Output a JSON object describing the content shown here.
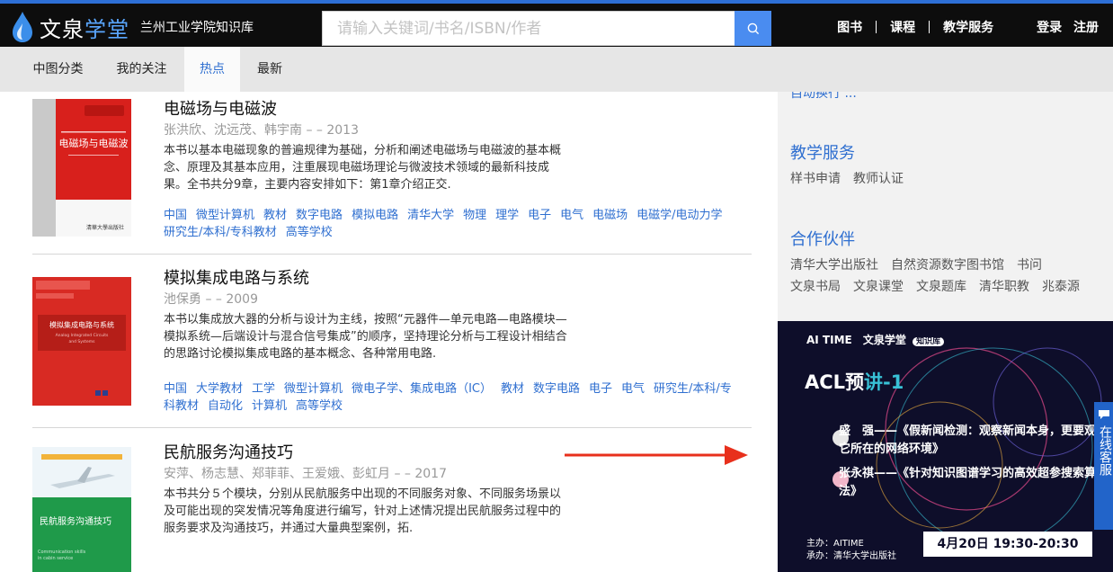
{
  "header": {
    "logo_main": "文泉",
    "logo_accent": "学堂",
    "site_name": "兰州工业学院知识库",
    "search_placeholder": "请输入关键词/书名/ISBN/作者",
    "nav": [
      "图书",
      "课程",
      "教学服务"
    ],
    "login": "登录",
    "register": "注册"
  },
  "tabs": [
    {
      "label": "中图分类",
      "active": false
    },
    {
      "label": "我的关注",
      "active": false
    },
    {
      "label": "热点",
      "active": true
    },
    {
      "label": "最新",
      "active": false
    }
  ],
  "books": [
    {
      "title": "电磁场与电磁波",
      "meta": "张洪欣、沈远茂、韩宇南 – – 2013",
      "desc": "本书以基本电磁现象的普遍规律为基础，分析和阐述电磁场与电磁波的基本概念、原理及其基本应用，注重展现电磁场理论与微波技术领域的最新科技成果。全书共分9章，主要内容安排如下：第1章介绍正交.",
      "tags": [
        "中国",
        "微型计算机",
        "教材",
        "数字电路",
        "模拟电路",
        "清华大学",
        "物理",
        "理学",
        "电子",
        "电气",
        "电磁场",
        "电磁学/电动力学",
        "研究生/本科/专科教材",
        "高等学校"
      ],
      "cover_title": "电磁场与电磁波",
      "cover_color": "#d8201c"
    },
    {
      "title": "模拟集成电路与系统",
      "meta": "池保勇 – – 2009",
      "desc": "本书以集成放大器的分析与设计为主线，按照“元器件—单元电路—电路模块—模拟系统—后端设计与混合信号集成”的顺序，坚持理论分析与工程设计相结合的思路讨论模拟集成电路的基本概念、各种常用电路.",
      "tags": [
        "中国",
        "大学教材",
        "工学",
        "微型计算机",
        "微电子学、集成电路（IC）",
        "教材",
        "数字电路",
        "电子",
        "电气",
        "研究生/本科/专科教材",
        "自动化",
        "计算机",
        "高等学校"
      ],
      "cover_title": "模拟集成电路与系统",
      "cover_subtitle": "Analog Integrated Circuits and Systems",
      "cover_color": "#d82a23"
    },
    {
      "title": "民航服务沟通技巧",
      "meta": "安萍、杨志慧、郑菲菲、王爱娥、彭虹月 – – 2017",
      "desc": "本书共分５个模块，分别从民航服务中出现的不同服务对象、不同服务场景以及可能出现的突发情况等角度进行编写，针对上述情况提出民航服务过程中的服务要求及沟通技巧，并通过大量典型案例，拓.",
      "tags": [],
      "cover_title": "民航服务沟通技巧",
      "cover_subtitle": "Communication skills in cabin service",
      "cover_color": "#1f9a4a"
    }
  ],
  "sidebar": {
    "top_cut_text": "自动换行 ...",
    "teaching": {
      "title": "教学服务",
      "links": [
        "样书申请",
        "教师认证"
      ]
    },
    "partners": {
      "title": "合作伙伴",
      "row1": [
        "清华大学出版社",
        "自然资源数字图书馆",
        "书问"
      ],
      "row2": [
        "文泉书局",
        "文泉课堂",
        "文泉题库",
        "清华职教",
        "兆泰源"
      ]
    }
  },
  "banner": {
    "brand1": "AI TIME",
    "brand2": "文泉学堂",
    "brand2_tag": "知识库",
    "headline_main": "ACL预",
    "headline_accent": "讲-1",
    "talk1_speaker": "盛　强——",
    "talk1_title": "《假新闻检测：观察新闻本身，更要观察它所在的网络环境》",
    "talk2_speaker": "张永祺——",
    "talk2_title": "《针对知识图谱学习的高效超参搜索算法》",
    "host": "主办：AITIME",
    "organizer": "承办：清华大学出版社",
    "datetime": "4月20日 19:30-20:30"
  },
  "float_button": "在线客服",
  "colors": {
    "accent": "#2f6fd0",
    "header_bg": "#0d0d0d",
    "annotation_arrow": "#e8301c"
  }
}
